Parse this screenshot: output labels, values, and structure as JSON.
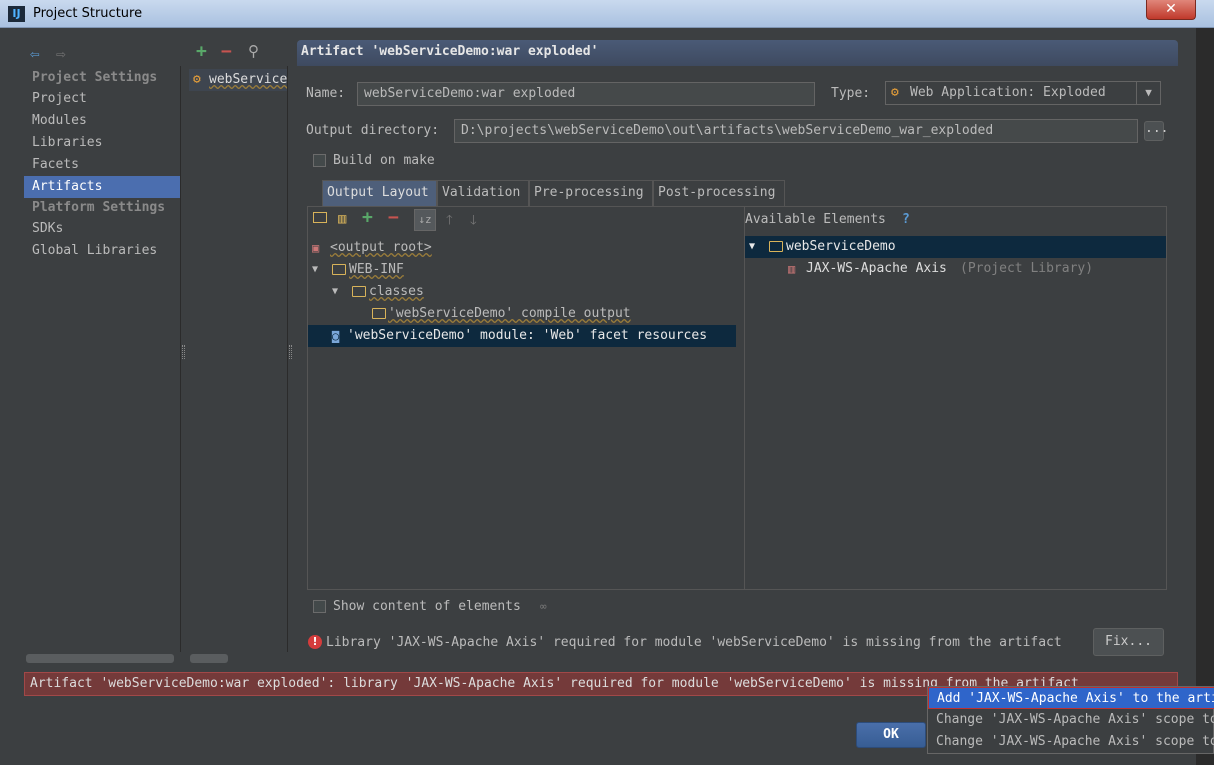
{
  "window": {
    "title": "Project Structure",
    "close_glyph": "✕"
  },
  "nav": {
    "sections": [
      {
        "header": "Project Settings",
        "items": [
          "Project",
          "Modules",
          "Libraries",
          "Facets",
          "Artifacts"
        ]
      },
      {
        "header": "Platform Settings",
        "items": [
          "SDKs",
          "Global Libraries"
        ]
      }
    ],
    "selected": "Artifacts"
  },
  "artifacts": {
    "items": [
      "webServiceDemo:war exploded"
    ],
    "visible_label": "webService"
  },
  "detail": {
    "header": "Artifact 'webServiceDemo:war exploded'",
    "name_label": "Name:",
    "name_value": "webServiceDemo:war exploded",
    "type_label": "Type:",
    "type_value": "Web Application: Exploded",
    "output_dir_label": "Output directory:",
    "output_dir_value": "D:\\projects\\webServiceDemo\\out\\artifacts\\webServiceDemo_war_exploded",
    "browse_label": "...",
    "build_on_make": "Build on make",
    "build_on_make_checked": false
  },
  "tabs": [
    "Output Layout",
    "Validation",
    "Pre-processing",
    "Post-processing"
  ],
  "active_tab": "Output Layout",
  "output_tree": [
    {
      "label": "<output root>",
      "icon": "output-root-icon"
    },
    {
      "label": "WEB-INF",
      "icon": "folder-icon",
      "expanded": true
    },
    {
      "label": "classes",
      "icon": "folder-icon",
      "expanded": true
    },
    {
      "label": "'webServiceDemo' compile output",
      "icon": "module-output-icon"
    },
    {
      "label": "'webServiceDemo' module: 'Web' facet resources",
      "icon": "web-facet-icon",
      "selected": true
    }
  ],
  "available": {
    "title": "Available Elements",
    "help": "?",
    "items": [
      {
        "label": "webServiceDemo",
        "icon": "module-folder-icon",
        "selected": true
      },
      {
        "label": "JAX-WS-Apache Axis",
        "suffix": "(Project Library)",
        "icon": "library-icon"
      }
    ]
  },
  "show_content": "Show content of elements",
  "warning": {
    "text": "Library 'JAX-WS-Apache Axis' required for module 'webServiceDemo' is missing from the artifact",
    "fix_label": "Fix..."
  },
  "error_bar": "Artifact 'webServiceDemo:war exploded': library 'JAX-WS-Apache Axis' required for module 'webServiceDemo' is missing from the artifact",
  "ok_label": "OK",
  "popup": [
    "Add 'JAX-WS-Apache Axis' to the artifact",
    "Change 'JAX-WS-Apache Axis' scope to Compile",
    "Change 'JAX-WS-Apache Axis' scope to Provided"
  ],
  "colors": {
    "accent": "#4b6eaf",
    "error": "#743a3a",
    "selection": "#0d293e",
    "popup_selection": "#2f65ca"
  }
}
